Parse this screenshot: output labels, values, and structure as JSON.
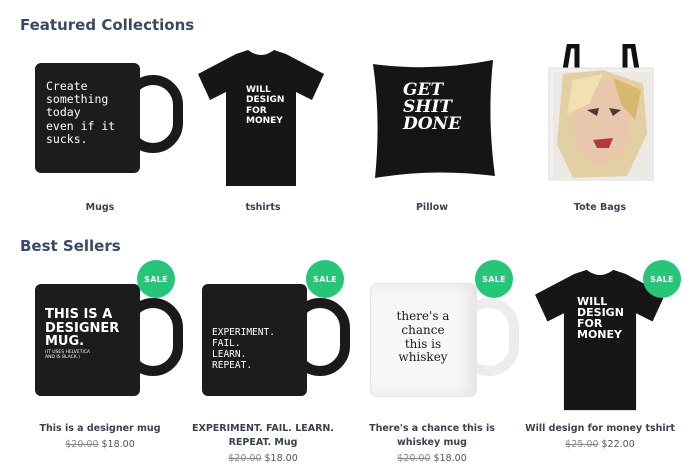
{
  "featured": {
    "title": "Featured Collections",
    "items": [
      {
        "label": "Mugs",
        "image_text": "Create\nsomething\ntoday\neven if it\nsucks."
      },
      {
        "label": "tshirts",
        "image_text": "WILL\nDESIGN\nFOR\nMONEY"
      },
      {
        "label": "Pillow",
        "image_text": "GET\nSHIT\nDONE"
      },
      {
        "label": "Tote Bags"
      }
    ]
  },
  "best_sellers": {
    "title": "Best Sellers",
    "sale_label": "SALE",
    "items": [
      {
        "name": "This is a designer mug",
        "old_price": "$20.00",
        "price": "$18.00",
        "image_text": "THIS IS A\nDESIGNER\nMUG.",
        "image_subtext": "(IT USES HELVETICA\nAND IS BLACK.)"
      },
      {
        "name": "EXPERIMENT. FAIL. LEARN. REPEAT. Mug",
        "old_price": "$20.00",
        "price": "$18.00",
        "image_text": "EXPERIMENT.\nFAIL.\nLEARN.\nREPEAT."
      },
      {
        "name": "There's a chance this is whiskey mug",
        "old_price": "$20.00",
        "price": "$18.00",
        "image_text": "there's a\nchance\nthis is\nwhiskey"
      },
      {
        "name": "Will design for money tshirt",
        "old_price": "$25.00",
        "price": "$22.00",
        "image_text": "WILL\nDESIGN\nFOR\nMONEY"
      }
    ]
  }
}
